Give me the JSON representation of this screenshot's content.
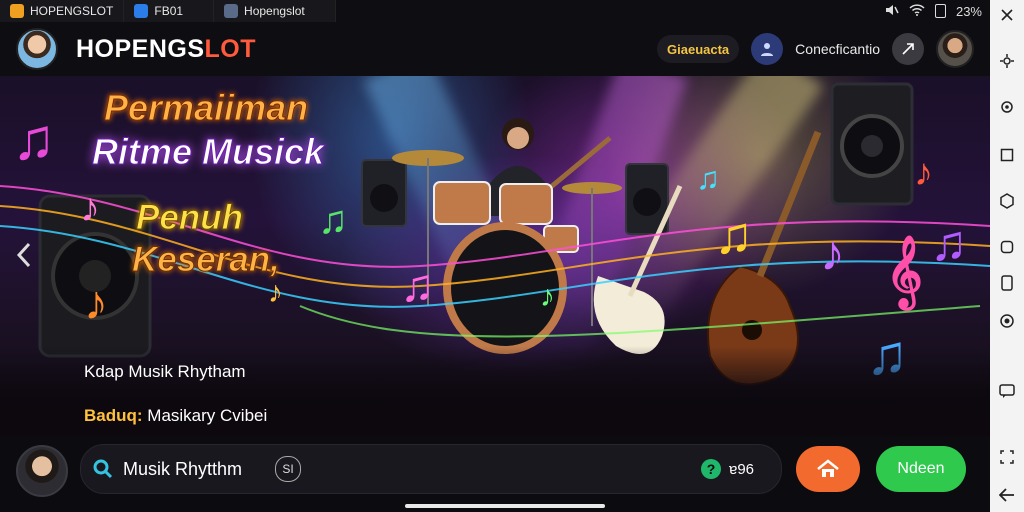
{
  "tabs": [
    {
      "label": "HOPENGSLOT",
      "icon": "app-icon",
      "color": "#f0a020"
    },
    {
      "label": "FB01",
      "icon": "app-icon",
      "color": "#2b7de9"
    },
    {
      "label": "Hopengslot",
      "icon": "app-icon",
      "color": "#5a6b8a"
    }
  ],
  "status": {
    "battery": "23%",
    "icons": [
      "mute-icon",
      "wifi-icon",
      "battery-icon"
    ]
  },
  "header": {
    "brand_prefix": "HOPENGS",
    "brand_suffix": "LOT",
    "pill_label": "Giaeuacta",
    "link_label": "Conecficantio",
    "share_icon": "share-icon"
  },
  "banner": {
    "headline_line1": "Permaiiman",
    "headline_line2": "Ritme Musick",
    "headline_line3": "Penuh",
    "headline_line4": "Keseran,",
    "subtitle": "Kdap Musik Rhytham",
    "label_key": "Baduq:",
    "label_value": "Masikary Cvibei"
  },
  "bottom": {
    "search_text": "Musik Rhytthm",
    "search_chip": "SI",
    "help_text": "ɐ96",
    "green_button": "Ndeen"
  },
  "colors": {
    "accent_orange": "#f26a2e",
    "accent_green": "#2fc94e",
    "brand_red": "#ff5a3c",
    "gold": "#f5c542"
  }
}
